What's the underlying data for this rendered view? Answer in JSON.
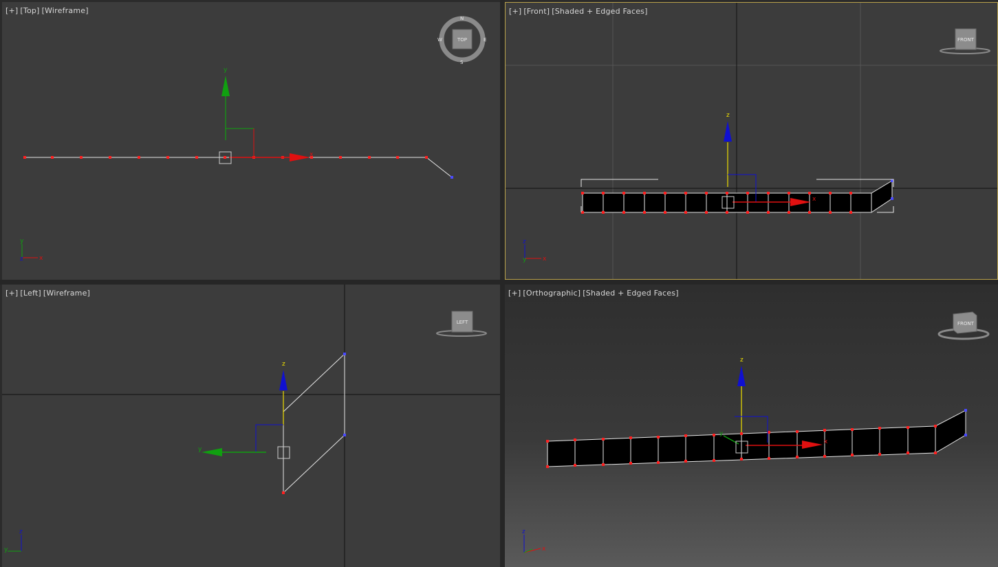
{
  "viewports": {
    "top": {
      "bracket_plus": "[+]",
      "view": "[Top]",
      "shading": "[Wireframe]",
      "cube_label": "TOP"
    },
    "front": {
      "bracket_plus": "[+]",
      "view": "[Front]",
      "shading": "[Shaded + Edged Faces]",
      "cube_label": "FRONT"
    },
    "left": {
      "bracket_plus": "[+]",
      "view": "[Left]",
      "shading": "[Wireframe]",
      "cube_label": "LEFT"
    },
    "persp": {
      "bracket_plus": "[+]",
      "view": "[Orthographic]",
      "shading": "[Shaded + Edged Faces]",
      "cube_label": "FRONT"
    }
  },
  "axes": {
    "x": "x",
    "y": "y",
    "z": "z"
  },
  "colors": {
    "active_border": "#b9a24c",
    "x_axis": "#e01010",
    "y_axis": "#10a010",
    "z_axis": "#1010d0",
    "gizmo_highlight": "#f0e000",
    "vertex": "#ff2020",
    "end_vertex": "#4a4aff"
  },
  "icons": [
    "viewcube-icon",
    "compass-ring-icon",
    "move-gizmo-icon",
    "axis-tripod-icon"
  ]
}
